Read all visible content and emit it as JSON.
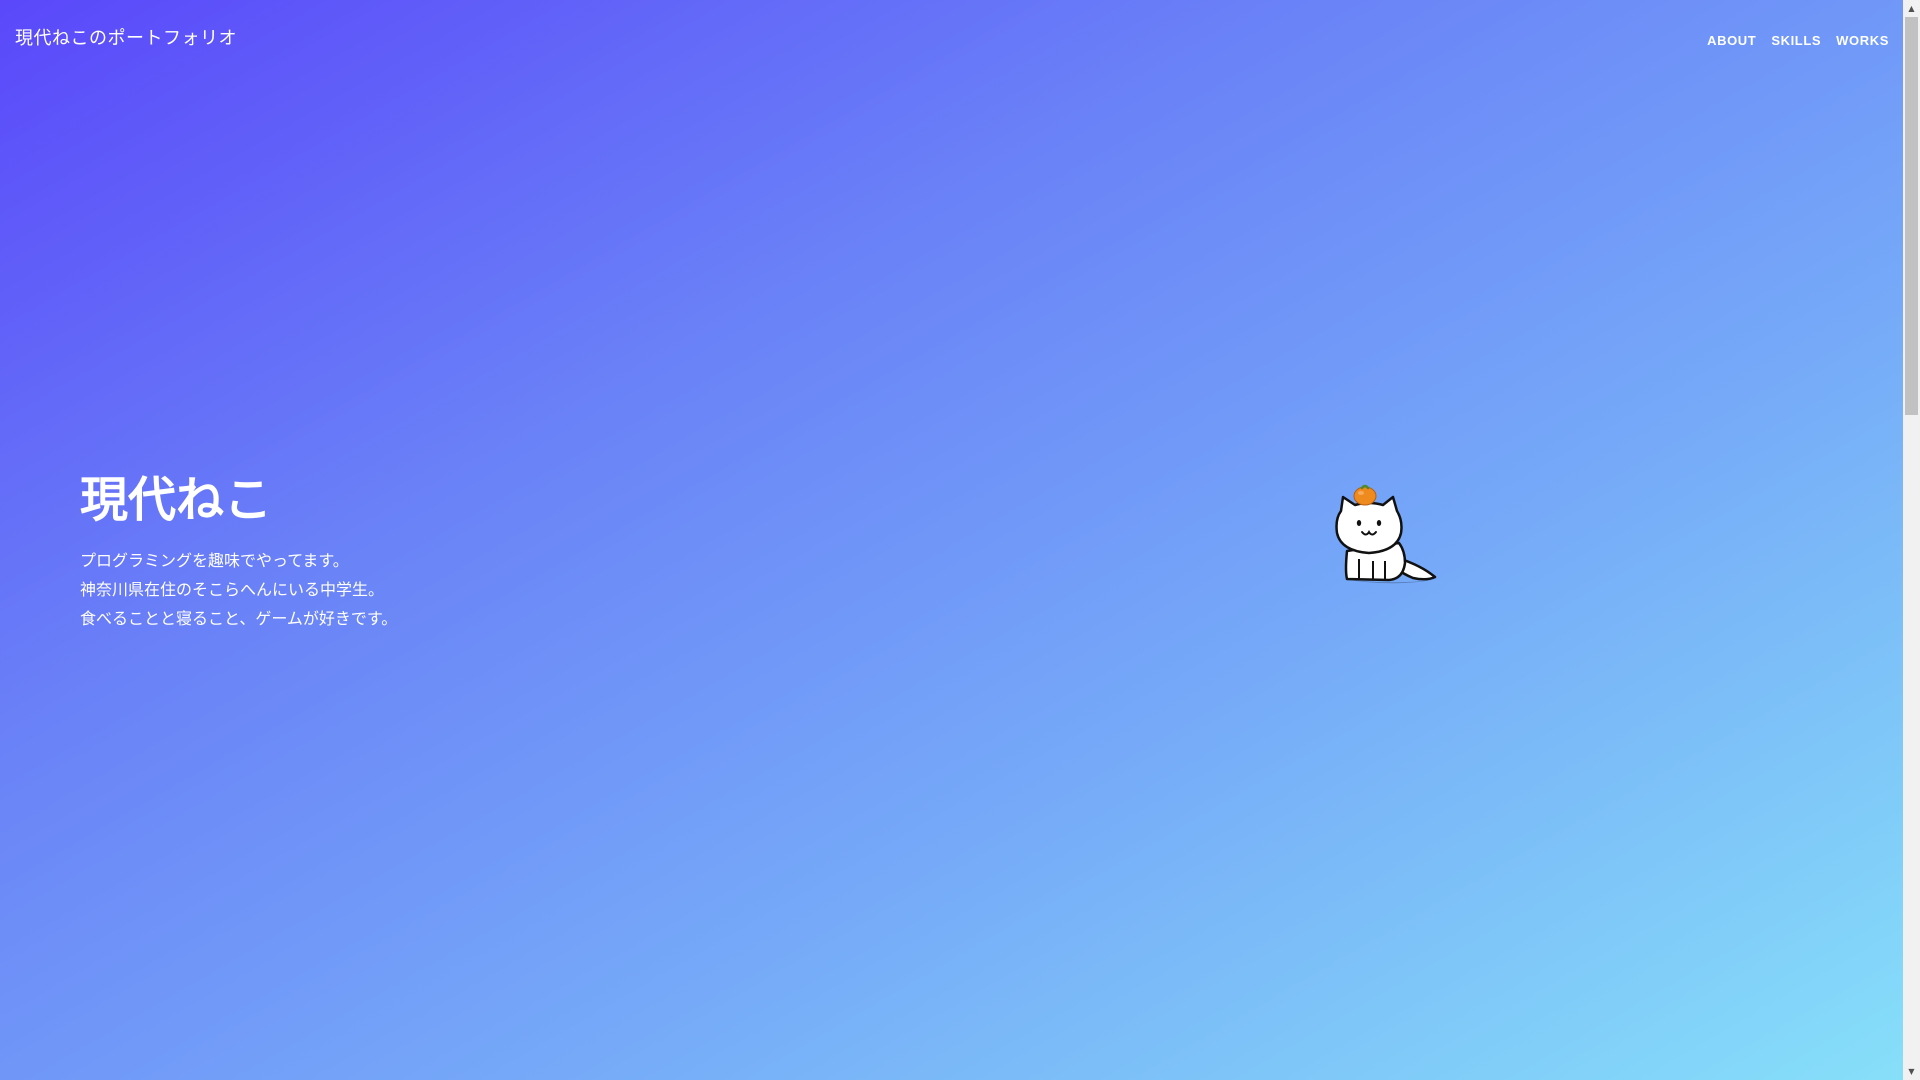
{
  "header": {
    "site_title": "現代ねこのポートフォリオ",
    "nav": [
      "ABOUT",
      "SKILLS",
      "WORKS"
    ]
  },
  "hero": {
    "name": "現代ねこ",
    "lines": [
      "プログラミングを趣味でやってます。",
      "神奈川県在住のそこらへんにいる中学生。",
      "食べることと寝ること、ゲームが好きです。"
    ],
    "illustration": "cat-with-mandarin-icon"
  },
  "colors": {
    "gradient_start": "#5a48fa",
    "gradient_end": "#86dff9",
    "text": "#ffffff",
    "mandarin": "#ef8a1f"
  },
  "scrollbar": {
    "up_icon": "chevron-up-icon",
    "down_icon": "chevron-down-icon"
  }
}
